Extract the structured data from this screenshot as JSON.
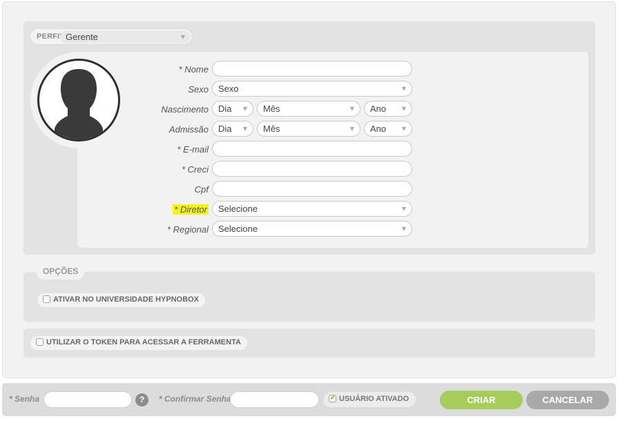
{
  "perfil": {
    "label": "PERFIL",
    "value": "Gerente"
  },
  "form": {
    "nome": {
      "label": "* Nome",
      "value": ""
    },
    "sexo": {
      "label": "Sexo",
      "value": "Sexo"
    },
    "nascimento": {
      "label": "Nascimento",
      "dia": "Dia",
      "mes": "Mês",
      "ano": "Ano"
    },
    "admissao": {
      "label": "Admissão",
      "dia": "Dia",
      "mes": "Mês",
      "ano": "Ano"
    },
    "email": {
      "label": "* E-mail",
      "value": ""
    },
    "creci": {
      "label": "* Creci",
      "value": ""
    },
    "cpf": {
      "label": "Cpf",
      "value": ""
    },
    "diretor": {
      "label": "* Diretor",
      "value": "Selecione",
      "highlight_color": "#f4f41a"
    },
    "regional": {
      "label": "* Regional",
      "value": "Selecione"
    }
  },
  "opcoes": {
    "title": "OPÇÕES",
    "universidade": {
      "label": "ATIVAR NO UNIVERSIDADE HYPNOBOX",
      "checked": false
    }
  },
  "token": {
    "label": "UTILIZAR O TOKEN PARA ACESSAR A FERRAMENTA",
    "checked": false
  },
  "footer": {
    "senha_label": "* Senha",
    "help_icon": "?",
    "confirmar_label": "* Confirmar Senha",
    "ativado": {
      "label": "USUÁRIO ATIVADO",
      "checked": true
    },
    "criar": "CRIAR",
    "cancelar": "CANCELAR"
  },
  "colors": {
    "criar": "#a6cc5b",
    "cancelar": "#a9a9a9",
    "check": "#7bbd2a"
  }
}
